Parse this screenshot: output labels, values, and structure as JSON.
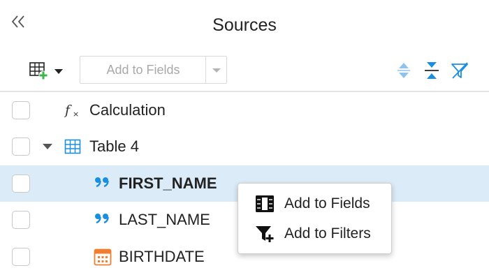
{
  "panel": {
    "title": "Sources",
    "collapse_icon": "double-chevron-left-icon"
  },
  "toolbar": {
    "add_table_icon": "add-table-icon",
    "add_to_fields_label": "Add to Fields",
    "expand_all_icon": "expand-all-icon",
    "collapse_all_icon": "collapse-all-icon",
    "filter_icon": "filter-icon"
  },
  "tree": {
    "rows": [
      {
        "label": "Calculation",
        "icon": "fx-icon",
        "selected": false
      },
      {
        "label": "Table 4",
        "icon": "table-icon",
        "expanded": true,
        "selected": false
      },
      {
        "label": "FIRST_NAME",
        "icon": "string-quote-icon",
        "selected": true
      },
      {
        "label": "LAST_NAME",
        "icon": "string-quote-icon",
        "selected": false
      },
      {
        "label": "BIRTHDATE",
        "icon": "calendar-icon",
        "selected": false
      }
    ]
  },
  "context_menu": {
    "items": [
      {
        "label": "Add to Fields",
        "icon": "columns-icon"
      },
      {
        "label": "Add to Filters",
        "icon": "add-filter-icon"
      }
    ]
  },
  "colors": {
    "accent": "#1a8fe0",
    "selection": "#dcebf8",
    "date_icon": "#f07d30",
    "add_green": "#3cb54a"
  }
}
